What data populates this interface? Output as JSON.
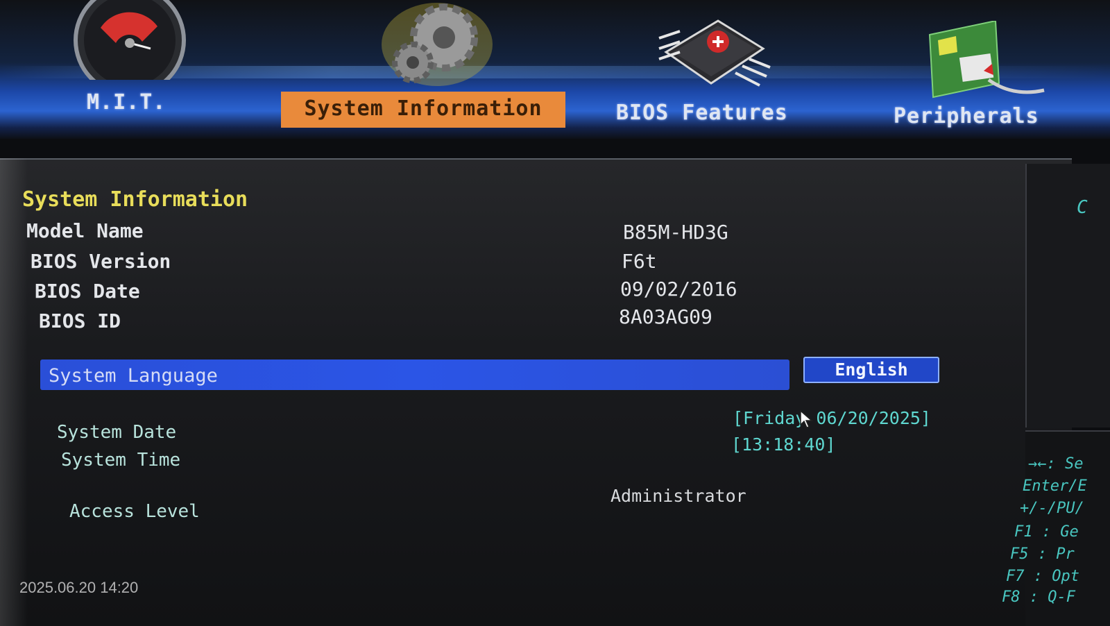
{
  "tabs": [
    {
      "label": "M.I.T.",
      "icon": "speedometer-icon",
      "active": false
    },
    {
      "label": "System Information",
      "icon": "gears-icon",
      "active": true
    },
    {
      "label": "BIOS Features",
      "icon": "chip-icon",
      "active": false
    },
    {
      "label": "Peripherals",
      "icon": "expansion-card-icon",
      "active": false
    }
  ],
  "main": {
    "section_title": "System Information",
    "info": [
      {
        "label": "Model Name",
        "value": "B85M-HD3G"
      },
      {
        "label": "BIOS Version",
        "value": "F6t"
      },
      {
        "label": "BIOS Date",
        "value": "09/02/2016"
      },
      {
        "label": "BIOS ID",
        "value": "8A03AG09"
      }
    ],
    "language": {
      "label": "System Language",
      "value": "English"
    },
    "date": {
      "label": "System Date",
      "value": "[Friday 06/20/2025]"
    },
    "time": {
      "label": "System Time",
      "value": "[13:18:40]"
    },
    "access": {
      "label": "Access Level",
      "value": "Administrator"
    }
  },
  "help": {
    "top": "C",
    "lines": [
      "→←: Se",
      "Enter/E",
      "+/-/PU/",
      "F1  : Ge",
      "F5  : Pr",
      "F7  : Opt",
      "F8  : Q-F"
    ]
  },
  "overlay_timestamp": "2025.06.20 14:20",
  "colors": {
    "active_tab": "#e98a3b",
    "section_title": "#e8dd5a",
    "highlight_bar": "#2b55e6",
    "teal_value": "#5fd7d0"
  }
}
